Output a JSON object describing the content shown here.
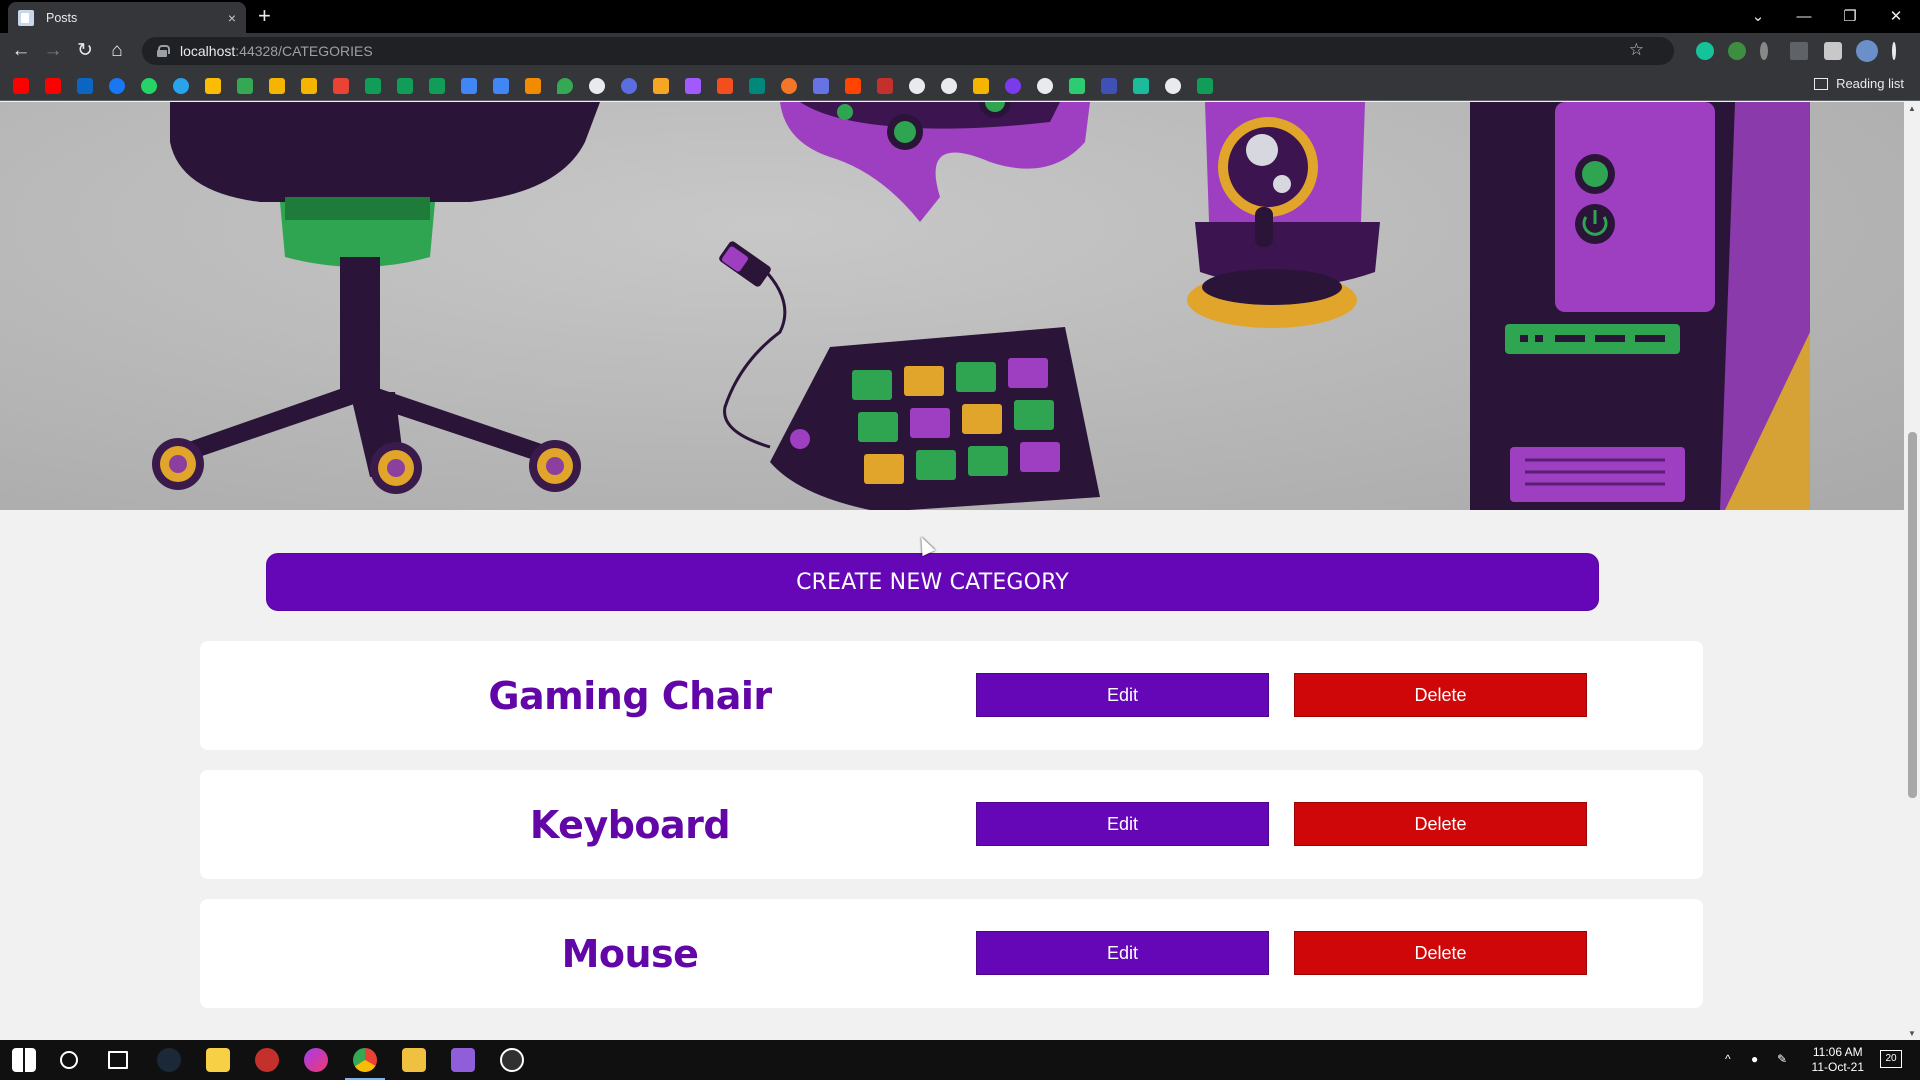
{
  "browser": {
    "tab_title": "Posts",
    "tab_close": "×",
    "new_tab": "+",
    "url_host": "localhost",
    "url_path": ":44328/CATEGORIES",
    "reading_list": "Reading list",
    "nav": {
      "back": "←",
      "forward": "→",
      "reload": "↻",
      "home": "⌂",
      "star": "☆"
    },
    "window": {
      "tabsearch": "⌄",
      "minimize": "—",
      "restore": "❐",
      "close": "✕"
    }
  },
  "page": {
    "create_button": "CREATE NEW CATEGORY",
    "categories": [
      {
        "name": "Gaming Chair",
        "edit": "Edit",
        "delete": "Delete"
      },
      {
        "name": "Keyboard",
        "edit": "Edit",
        "delete": "Delete"
      },
      {
        "name": "Mouse",
        "edit": "Edit",
        "delete": "Delete"
      }
    ]
  },
  "taskbar": {
    "time": "11:06 AM",
    "date": "11-Oct-21",
    "notifications": "20"
  },
  "colors": {
    "primary_purple": "#6507b6",
    "delete_red": "#cf0709",
    "heading_purple": "#6206a8"
  }
}
